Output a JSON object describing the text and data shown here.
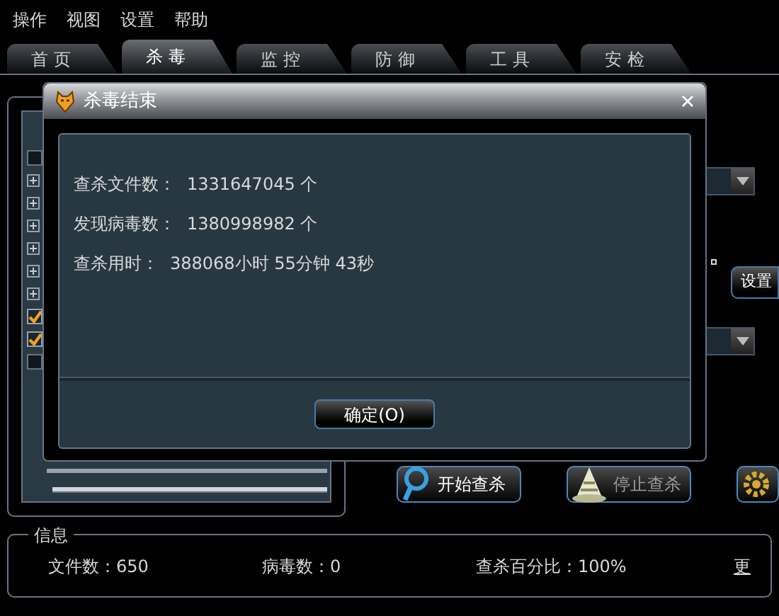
{
  "menu": [
    "操作",
    "视图",
    "设置",
    "帮助"
  ],
  "tabs": [
    {
      "label": "首页",
      "selected": false
    },
    {
      "label": "杀毒",
      "selected": true
    },
    {
      "label": "监控",
      "selected": false
    },
    {
      "label": "防御",
      "selected": false
    },
    {
      "label": "工具",
      "selected": false
    },
    {
      "label": "安检",
      "selected": false
    }
  ],
  "tree": [
    {
      "kind": "checkbox",
      "checked": false
    },
    {
      "kind": "expander"
    },
    {
      "kind": "expander"
    },
    {
      "kind": "expander"
    },
    {
      "kind": "expander"
    },
    {
      "kind": "expander"
    },
    {
      "kind": "expander"
    },
    {
      "kind": "checkbox",
      "checked": true
    },
    {
      "kind": "checkbox",
      "checked": true
    },
    {
      "kind": "checkbox",
      "checked": false
    }
  ],
  "settings_button": "设置",
  "actions": [
    {
      "kind": "search",
      "label": "开始查杀",
      "disabled": false
    },
    {
      "kind": "cone",
      "label": "停止查杀",
      "disabled": true
    },
    {
      "kind": "gear"
    }
  ],
  "info": {
    "title": "信息",
    "items": [
      "文件数：650",
      "病毒数：0",
      "查杀百分比：100%"
    ],
    "more_link": "更"
  },
  "dialog": {
    "title": "杀毒结束",
    "rows": [
      {
        "label": "查杀文件数：",
        "value": "1331647045 个"
      },
      {
        "label": "发现病毒数：",
        "value": "1380998982 个"
      },
      {
        "label": "查杀用时：",
        "value": "388068小时 55分钟 43秒"
      }
    ],
    "ok_button": "确定(O)"
  }
}
